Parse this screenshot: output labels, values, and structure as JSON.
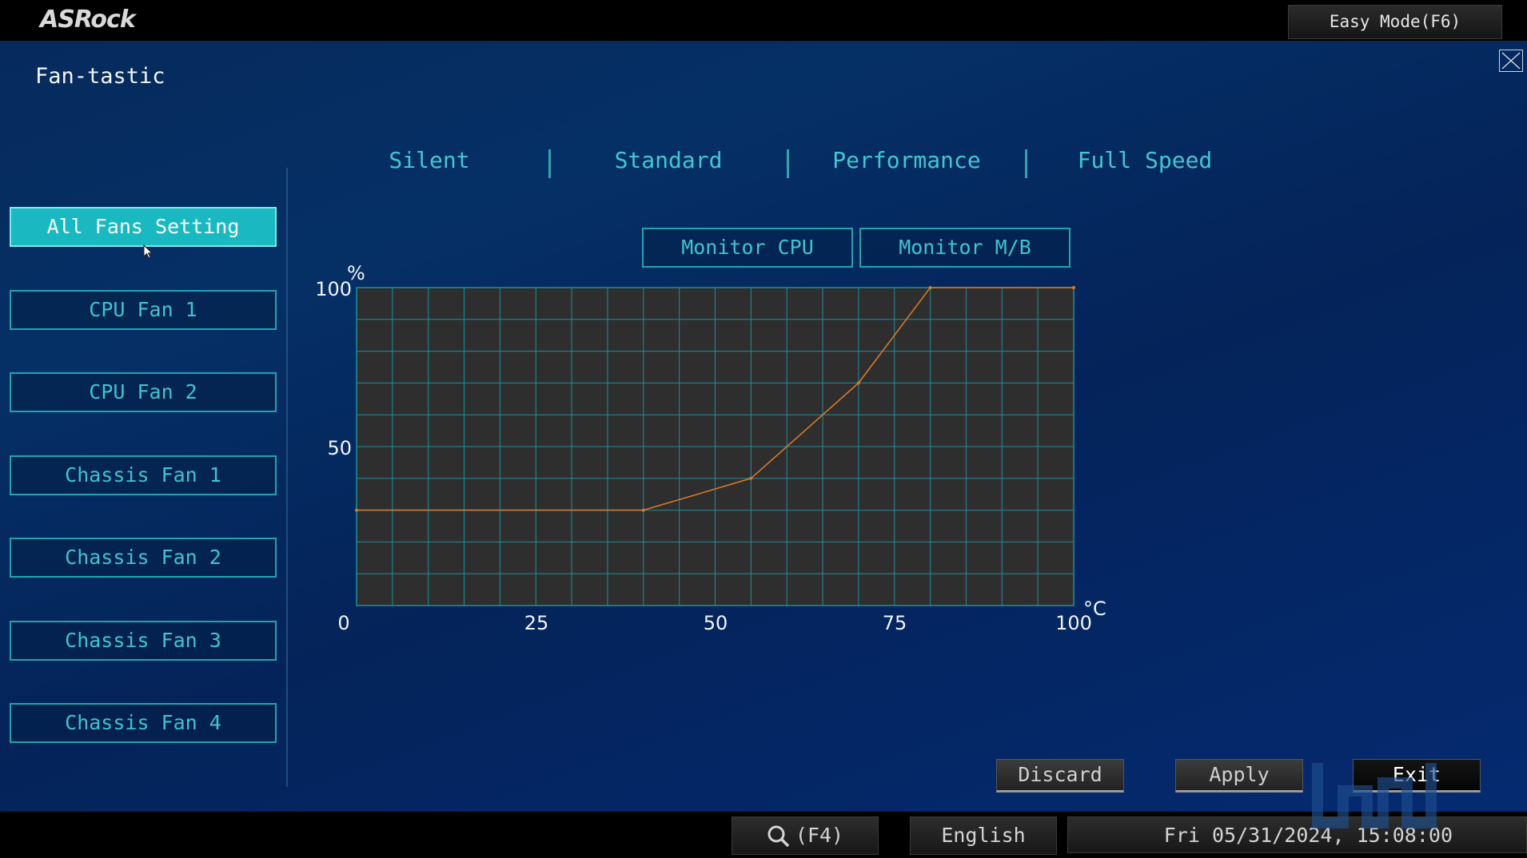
{
  "header": {
    "logo": "ASRock",
    "easy_mode_label": "Easy Mode(F6)"
  },
  "page": {
    "title": "Fan-tastic"
  },
  "presets": [
    {
      "label": "Silent"
    },
    {
      "label": "Standard"
    },
    {
      "label": "Performance"
    },
    {
      "label": "Full Speed"
    }
  ],
  "fans": [
    {
      "label": "All Fans Setting",
      "selected": true
    },
    {
      "label": "CPU Fan 1"
    },
    {
      "label": "CPU Fan 2"
    },
    {
      "label": "Chassis Fan 1"
    },
    {
      "label": "Chassis Fan 2"
    },
    {
      "label": "Chassis Fan 3"
    },
    {
      "label": "Chassis Fan 4"
    }
  ],
  "monitor": {
    "cpu_label": "Monitor CPU",
    "mb_label": "Monitor M/B"
  },
  "chart_data": {
    "type": "line",
    "x_unit": "°C",
    "y_unit": "%",
    "xlim": [
      0,
      100
    ],
    "ylim": [
      0,
      100
    ],
    "x_ticks": [
      "0",
      "25",
      "50",
      "75",
      "100"
    ],
    "y_ticks": [
      "100",
      "50"
    ],
    "grid": true,
    "line_color": "#d47a2a",
    "series": [
      {
        "x": [
          0,
          40,
          55,
          70,
          80,
          100
        ],
        "y": [
          30,
          30,
          40,
          70,
          100,
          100
        ]
      }
    ]
  },
  "actions": {
    "discard_label": "Discard",
    "apply_label": "Apply",
    "exit_label": "Exit"
  },
  "footer": {
    "search_label": "(F4)",
    "language": "English",
    "datetime": "Fri 05/31/2024, 15:08:00"
  }
}
